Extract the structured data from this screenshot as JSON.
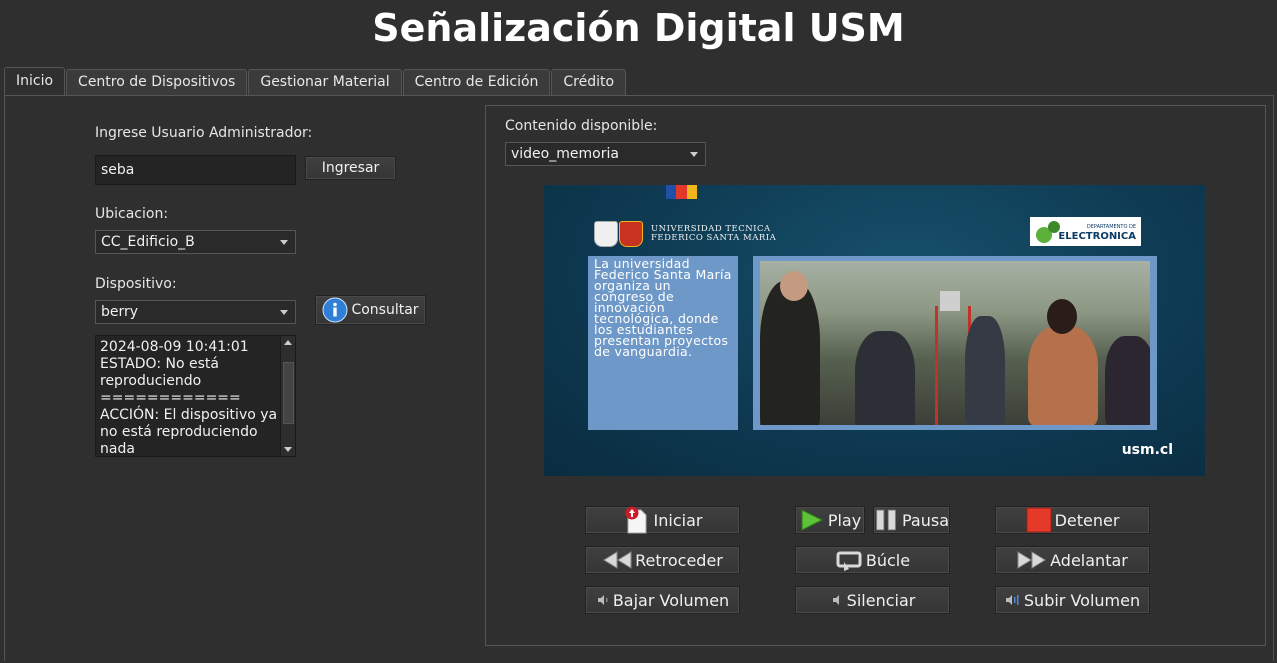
{
  "app": {
    "title": "Señalización Digital USM"
  },
  "tabs": [
    {
      "label": "Inicio",
      "active": true
    },
    {
      "label": "Centro de Dispositivos",
      "active": false
    },
    {
      "label": "Gestionar Material",
      "active": false
    },
    {
      "label": "Centro de Edición",
      "active": false
    },
    {
      "label": "Crédito",
      "active": false
    }
  ],
  "login": {
    "label": "Ingrese Usuario Administrador:",
    "user_value": "seba",
    "button": "Ingresar"
  },
  "location": {
    "label": "Ubicacion:",
    "selected": "CC_Edificio_B"
  },
  "device": {
    "label": "Dispositivo:",
    "selected": "berry",
    "button": "Consultar"
  },
  "log": {
    "lines": [
      "2024-08-09 10:41:01",
      "ESTADO: No está reproduciendo",
      "============",
      "ACCIÓN: El dispositivo ya no está reproduciendo nada"
    ]
  },
  "content": {
    "label": "Contenido disponible:",
    "selected": "video_memoria"
  },
  "video": {
    "university_line1": "UNIVERSIDAD TECNICA",
    "university_line2": "FEDERICO SANTA MARIA",
    "dept_label": "ELECTRONICA",
    "dept_small": "DEPARTAMENTO DE",
    "caption": "La universidad Federico Santa María organiza un congreso de innovación tecnológica, donde los estudiantes presentan proyectos de vanguardia.",
    "footer": "usm.cl",
    "flag_colors": [
      "#1f4fa8",
      "#e0392b",
      "#f2b51c"
    ]
  },
  "controls": {
    "start": "Iniciar",
    "play": "Play",
    "pause": "Pausa",
    "stop": "Detener",
    "rewind": "Retroceder",
    "loop": "Búcle",
    "forward": "Adelantar",
    "vol_down": "Bajar Volumen",
    "mute": "Silenciar",
    "vol_up": "Subir Volumen"
  },
  "colors": {
    "background": "#2f2f2f",
    "play_green": "#5fc33a",
    "stop_red": "#e53a2a",
    "info_blue": "#2f7fd6"
  }
}
